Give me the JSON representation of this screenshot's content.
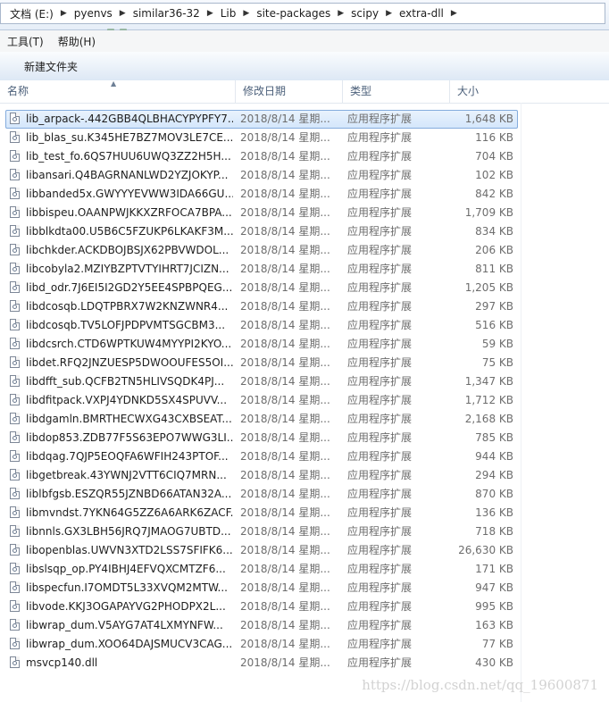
{
  "breadcrumb": [
    "文档 (E:)",
    "pyenvs",
    "similar36-32",
    "Lib",
    "site-packages",
    "scipy",
    "extra-dll"
  ],
  "menu": [
    "工具(T)",
    "帮助(H)"
  ],
  "toolbar": {
    "new_folder_label": "新建文件夹"
  },
  "columns": {
    "name": "名称",
    "date": "修改日期",
    "type": "类型",
    "size": "大小"
  },
  "files": [
    {
      "name": "lib_arpack-.442GBB4QLBHACYPYPFY7...",
      "date": "2018/8/14 星期...",
      "type": "应用程序扩展",
      "size": "1,648 KB",
      "selected": true
    },
    {
      "name": "lib_blas_su.K345HE7BZ7MOV3LE7CE...",
      "date": "2018/8/14 星期...",
      "type": "应用程序扩展",
      "size": "116 KB"
    },
    {
      "name": "lib_test_fo.6QS7HUU6UWQ3ZZ2H5H...",
      "date": "2018/8/14 星期...",
      "type": "应用程序扩展",
      "size": "704 KB"
    },
    {
      "name": "libansari.Q4BAGRNANLWD2YZJOKYP...",
      "date": "2018/8/14 星期...",
      "type": "应用程序扩展",
      "size": "102 KB"
    },
    {
      "name": "libbanded5x.GWYYYEVWW3IDA66GU...",
      "date": "2018/8/14 星期...",
      "type": "应用程序扩展",
      "size": "842 KB"
    },
    {
      "name": "libbispeu.OAANPWJKKXZRFOCA7BPA...",
      "date": "2018/8/14 星期...",
      "type": "应用程序扩展",
      "size": "1,709 KB"
    },
    {
      "name": "libblkdta00.U5B6C5FZUKP6LKAKF3M...",
      "date": "2018/8/14 星期...",
      "type": "应用程序扩展",
      "size": "834 KB"
    },
    {
      "name": "libchkder.ACKDBOJBSJX62PBVWDOL...",
      "date": "2018/8/14 星期...",
      "type": "应用程序扩展",
      "size": "206 KB"
    },
    {
      "name": "libcobyla2.MZIYBZPTVTYIHRT7JCIZN...",
      "date": "2018/8/14 星期...",
      "type": "应用程序扩展",
      "size": "811 KB"
    },
    {
      "name": "libd_odr.7J6EI5I2GD2Y5EE4SPBPQEG...",
      "date": "2018/8/14 星期...",
      "type": "应用程序扩展",
      "size": "1,205 KB"
    },
    {
      "name": "libdcosqb.LDQTPBRX7W2KNZWNR4...",
      "date": "2018/8/14 星期...",
      "type": "应用程序扩展",
      "size": "297 KB"
    },
    {
      "name": "libdcosqb.TV5LOFJPDPVMTSGCBM3...",
      "date": "2018/8/14 星期...",
      "type": "应用程序扩展",
      "size": "516 KB"
    },
    {
      "name": "libdcsrch.CTD6WPTKUW4MYYPI2KYO...",
      "date": "2018/8/14 星期...",
      "type": "应用程序扩展",
      "size": "59 KB"
    },
    {
      "name": "libdet.RFQ2JNZUESP5DWOOUFES5OI...",
      "date": "2018/8/14 星期...",
      "type": "应用程序扩展",
      "size": "75 KB"
    },
    {
      "name": "libdfft_sub.QCFB2TN5HLIVSQDK4PJ...",
      "date": "2018/8/14 星期...",
      "type": "应用程序扩展",
      "size": "1,347 KB"
    },
    {
      "name": "libdfitpack.VXPJ4YDNKD5SX4SPUVV...",
      "date": "2018/8/14 星期...",
      "type": "应用程序扩展",
      "size": "1,712 KB"
    },
    {
      "name": "libdgamln.BMRTHECWXG43CXBSEAT...",
      "date": "2018/8/14 星期...",
      "type": "应用程序扩展",
      "size": "2,168 KB"
    },
    {
      "name": "libdop853.ZDB77F5S63EPO7WWG3LI...",
      "date": "2018/8/14 星期...",
      "type": "应用程序扩展",
      "size": "785 KB"
    },
    {
      "name": "libdqag.7QJP5EOQFA6WFIH243PTOF...",
      "date": "2018/8/14 星期...",
      "type": "应用程序扩展",
      "size": "944 KB"
    },
    {
      "name": "libgetbreak.43YWNJ2VTT6CIQ7MRN...",
      "date": "2018/8/14 星期...",
      "type": "应用程序扩展",
      "size": "294 KB"
    },
    {
      "name": "liblbfgsb.ESZQR55JZNBD66ATAN32A...",
      "date": "2018/8/14 星期...",
      "type": "应用程序扩展",
      "size": "870 KB"
    },
    {
      "name": "libmvndst.7YKN64G5ZZ6A6ARK6ZACF...",
      "date": "2018/8/14 星期...",
      "type": "应用程序扩展",
      "size": "136 KB"
    },
    {
      "name": "libnnls.GX3LBH56JRQ7JMAOG7UBTD...",
      "date": "2018/8/14 星期...",
      "type": "应用程序扩展",
      "size": "718 KB"
    },
    {
      "name": "libopenblas.UWVN3XTD2LSS7SFIFK6...",
      "date": "2018/8/14 星期...",
      "type": "应用程序扩展",
      "size": "26,630 KB"
    },
    {
      "name": "libslsqp_op.PY4IBHJ4EFVQXCMTZF6...",
      "date": "2018/8/14 星期...",
      "type": "应用程序扩展",
      "size": "171 KB"
    },
    {
      "name": "libspecfun.I7OMDT5L33XVQM2MTW...",
      "date": "2018/8/14 星期...",
      "type": "应用程序扩展",
      "size": "947 KB"
    },
    {
      "name": "libvode.KKJ3OGAPAYVG2PHODPX2L...",
      "date": "2018/8/14 星期...",
      "type": "应用程序扩展",
      "size": "995 KB"
    },
    {
      "name": "libwrap_dum.V5AYG7AT4LXMYNFW...",
      "date": "2018/8/14 星期...",
      "type": "应用程序扩展",
      "size": "163 KB"
    },
    {
      "name": "libwrap_dum.XOO64DAJSMUCV3CAG...",
      "date": "2018/8/14 星期...",
      "type": "应用程序扩展",
      "size": "77 KB"
    },
    {
      "name": "msvcp140.dll",
      "date": "2018/8/14 星期...",
      "type": "应用程序扩展",
      "size": "430 KB"
    }
  ],
  "watermark": "https://blog.csdn.net/qq_19600871",
  "icons": {
    "file": "dll-file-icon",
    "sort": "sort-up-arrow-icon",
    "separator": "chevron-right-icon"
  },
  "colors": {
    "selection": "#d3e6fb",
    "header_text": "#4c607a"
  }
}
